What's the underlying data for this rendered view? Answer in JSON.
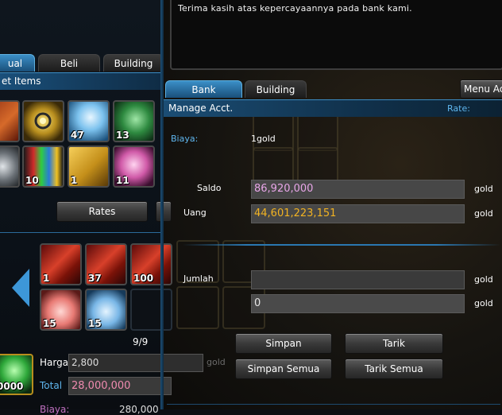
{
  "message": "Terima kasih atas kepercayaannya pada bank kami.",
  "left_panel": {
    "tabs": [
      "ual",
      "Beli",
      "Building"
    ],
    "header": "et Items",
    "items_row1": [
      {
        "icon": "red-book-icon",
        "qty": ""
      },
      {
        "icon": "gold-scroll-icon",
        "qty": ""
      },
      {
        "icon": "blue-wing-icon",
        "qty": "47"
      },
      {
        "icon": "green-scroll-icon",
        "qty": "13"
      }
    ],
    "items_row2": [
      {
        "icon": "silver-gem-icon",
        "qty": ""
      },
      {
        "icon": "crystal-cluster-icon",
        "qty": "10"
      },
      {
        "icon": "gold-book-icon",
        "qty": "1"
      },
      {
        "icon": "pink-crystal-icon",
        "qty": "11"
      }
    ],
    "rates_button": "Rates",
    "sell_row1": [
      {
        "icon": "red-spike-icon",
        "qty": "1"
      },
      {
        "icon": "red-spike-icon",
        "qty": "37"
      },
      {
        "icon": "red-spike-icon",
        "qty": "100"
      }
    ],
    "sell_row2": [
      {
        "icon": "red-potion-icon",
        "qty": "15"
      },
      {
        "icon": "blue-potion-icon",
        "qty": "15"
      },
      {
        "icon": "empty-slot",
        "qty": ""
      }
    ],
    "page": "9/9",
    "harga_label": "Harga",
    "harga_value": "2,800",
    "total_label": "Total",
    "total_value": "28,000,000",
    "biaya_label": "Biaya:",
    "biaya_value": "280,000",
    "item_qty": "0000",
    "gold_label": "gold"
  },
  "bank": {
    "tabs": [
      "Bank",
      "Building"
    ],
    "menu_button": "Menu Ac",
    "header": "Manage Acct.",
    "rate_label": "Rate:",
    "biaya_label": "Biaya:",
    "biaya_value": "1gold",
    "saldo_label": "Saldo",
    "saldo_value": "86,920,000",
    "uang_label": "Uang",
    "uang_value": "44,601,223,151",
    "jumlah_label": "Jumlah",
    "jumlah_value": "",
    "second_value": "0",
    "gold_unit": "gold",
    "buttons": {
      "simpan": "Simpan",
      "tarik": "Tarik",
      "simpan_semua": "Simpan Semua",
      "tarik_semua": "Tarik Semua"
    }
  },
  "colors": {
    "accent_blue": "#3b8fc7",
    "saldo_text": "#e8a6e8",
    "uang_text": "#f2b322",
    "total_text": "#f08bb0",
    "label_blue": "#5fb6ee"
  }
}
